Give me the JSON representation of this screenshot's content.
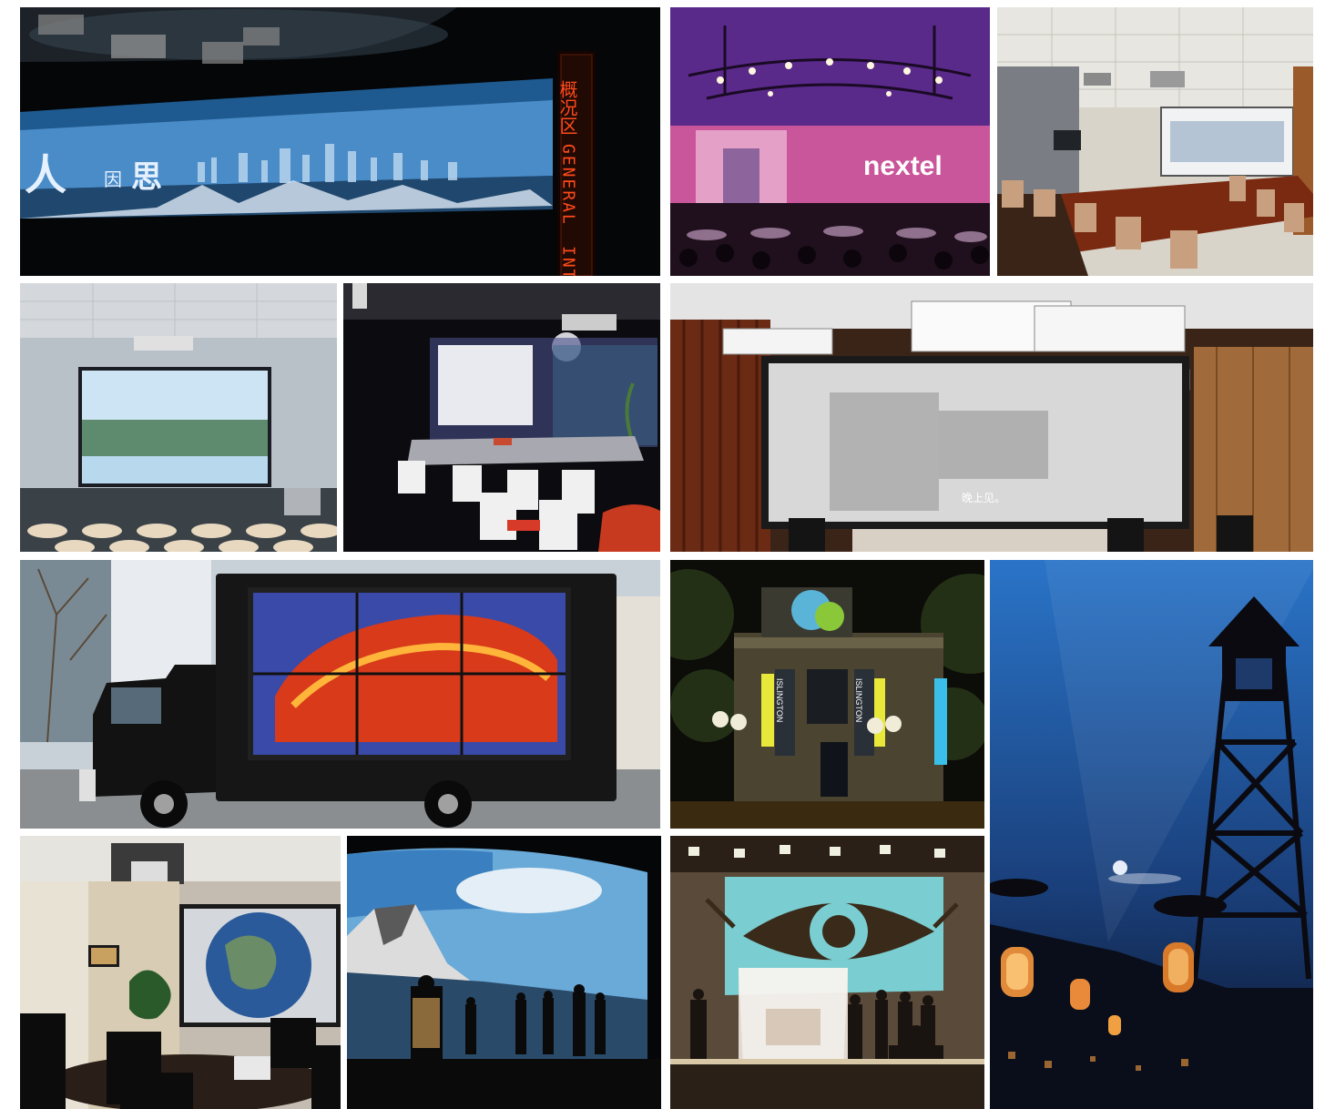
{
  "panels": [
    {
      "name": "curved-screen-control-room",
      "overlay": [
        "概况区",
        "GENERAL",
        "INT"
      ],
      "screen_text": [
        "人",
        "因",
        "思"
      ]
    },
    {
      "name": "event-stage-nextel",
      "overlay": [
        "nextel"
      ]
    },
    {
      "name": "boardroom-projection",
      "overlay": []
    },
    {
      "name": "lecture-hall-screen",
      "overlay": []
    },
    {
      "name": "meeting-room-screen",
      "overlay": []
    },
    {
      "name": "home-theater-screen",
      "overlay": [
        "晚上见。"
      ]
    },
    {
      "name": "led-truck-advertising",
      "overlay": []
    },
    {
      "name": "building-projection-mapping",
      "overlay": [
        "ISLINGTON",
        "ISLINGTON"
      ]
    },
    {
      "name": "night-street-tower",
      "overlay": []
    },
    {
      "name": "conference-room-earth-screen",
      "overlay": []
    },
    {
      "name": "immersive-mountain-screen",
      "overlay": []
    },
    {
      "name": "theater-stage-eye-projection",
      "overlay": []
    }
  ],
  "colors": {
    "purple": "#7a2a9a",
    "night_blue": "#1a3f7a",
    "screen_blue": "#4a90d0",
    "warm_wood": "#8a3a1a"
  }
}
